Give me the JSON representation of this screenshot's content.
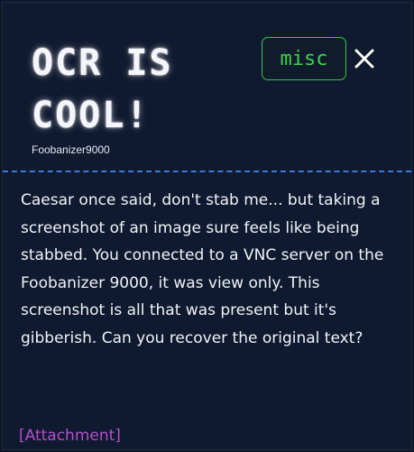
{
  "challenge": {
    "title": "OCR IS COOL!",
    "author": "Foobanizer9000",
    "category": "misc",
    "description": "Caesar once said, don't stab me... but taking a screenshot of an image sure feels like being stabbed. You connected to a VNC server on the Foobanizer 9000, it was view only. This screenshot is all that was present but it's gibberish. Can you recover the original text?",
    "attachment_label": "[Attachment]",
    "close_icon": "close-icon"
  },
  "colors": {
    "background": "#0d1526",
    "modal_bg": "#101a30",
    "divider": "#3b78d8",
    "badge": "#3ed14f",
    "attachment": "#b64ecf",
    "text": "#f1f3f8"
  }
}
